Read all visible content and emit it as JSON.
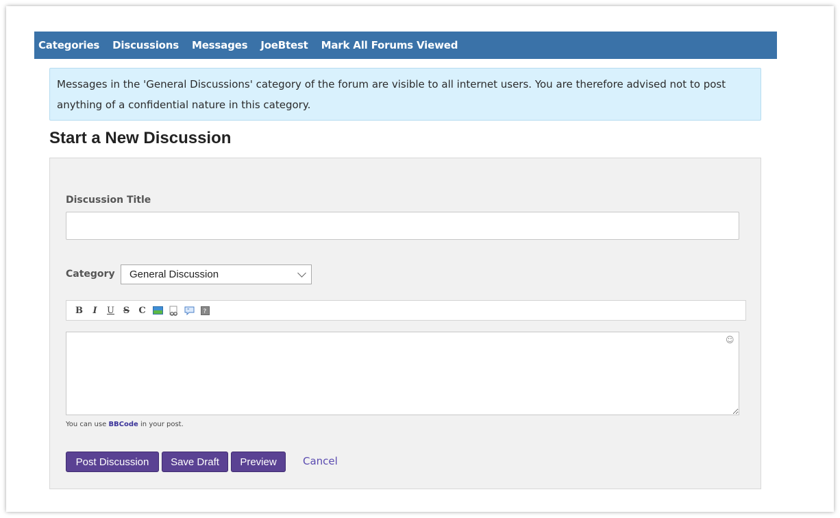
{
  "nav": {
    "items": [
      "Categories",
      "Discussions",
      "Messages",
      "JoeBtest",
      "Mark All Forums Viewed"
    ]
  },
  "notice": {
    "text": "Messages in the 'General Discussions' category of the forum are visible to all internet users. You are therefore advised not to post anything of a confidential nature in this category."
  },
  "page_title": "Start a New Discussion",
  "form": {
    "title_label": "Discussion Title",
    "title_value": "",
    "category_label": "Category",
    "category_selected": "General Discussion",
    "toolbar": {
      "bold": "B",
      "italic": "I",
      "underline": "U",
      "strike": "S",
      "code": "C",
      "buttons_icons": [
        "image-icon",
        "link-icon",
        "quote-icon",
        "spoiler-icon"
      ]
    },
    "editor_value": "",
    "bbcode_prefix": "You can use ",
    "bbcode_link": "BBCode",
    "bbcode_suffix": " in your post.",
    "buttons": {
      "post": "Post Discussion",
      "save_draft": "Save Draft",
      "preview": "Preview",
      "cancel": "Cancel"
    }
  },
  "colors": {
    "navbar": "#3a72a8",
    "notice_bg": "#d9f1fd",
    "button": "#5a4293",
    "link": "#5a4bb0"
  }
}
